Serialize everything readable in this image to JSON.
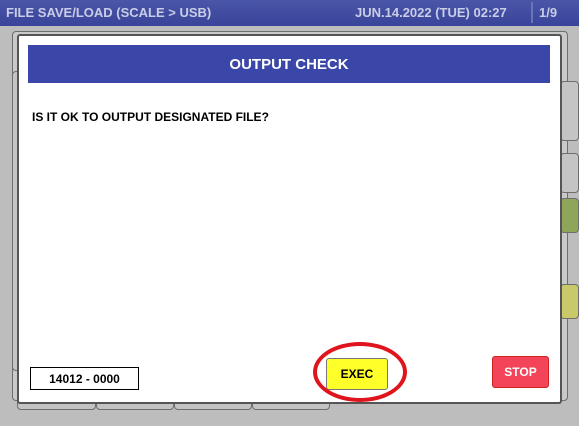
{
  "status_bar": {
    "title": "FILE SAVE/LOAD (SCALE > USB)",
    "datetime": "JUN.14.2022 (TUE)  02:27",
    "page": "1/9"
  },
  "dialog": {
    "title": "OUTPUT CHECK",
    "message": "IS IT OK TO OUTPUT DESIGNATED FILE?",
    "file_range": "14012 - 0000",
    "exec_label": "EXEC",
    "stop_label": "STOP"
  },
  "colors": {
    "header": "#3a46a8",
    "exec_button": "#ffff2a",
    "stop_button": "#f4445a",
    "highlight_circle": "#e0141c"
  }
}
